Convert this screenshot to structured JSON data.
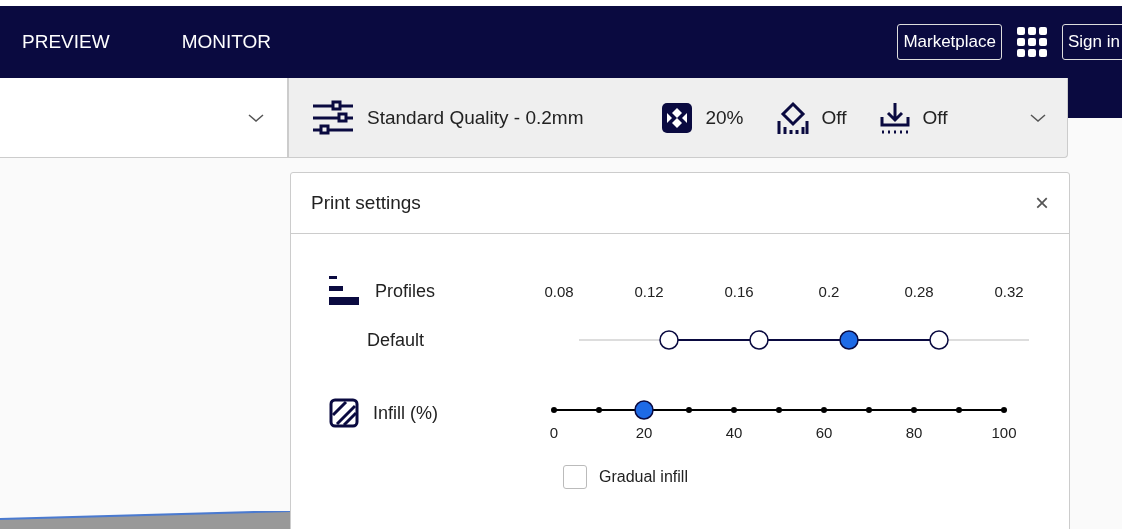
{
  "header": {
    "tabs": [
      {
        "label": "PREVIEW",
        "selected": false
      },
      {
        "label": "MONITOR",
        "selected": false
      }
    ],
    "marketplace_button": "Marketplace",
    "sign_in_button": "Sign in"
  },
  "settings_bar": {
    "profile": "Standard Quality - 0.2mm",
    "infill": "20%",
    "support": "Off",
    "adhesion": "Off"
  },
  "panel": {
    "title": "Print settings",
    "close": "×",
    "profiles": {
      "label": "Profiles",
      "sublabel": "Default",
      "stops": [
        {
          "label": "0.08",
          "available": false,
          "selected": false
        },
        {
          "label": "0.12",
          "available": true,
          "selected": false
        },
        {
          "label": "0.16",
          "available": true,
          "selected": false
        },
        {
          "label": "0.2",
          "available": true,
          "selected": true
        },
        {
          "label": "0.28",
          "available": true,
          "selected": false
        },
        {
          "label": "0.32",
          "available": false,
          "selected": false
        }
      ]
    },
    "infill": {
      "label": "Infill (%)",
      "level": 0.2,
      "ticks": [
        "0",
        "20",
        "40",
        "60",
        "80",
        "100"
      ]
    },
    "gradual_infill": {
      "label": "Gradual infill",
      "checked": false
    }
  }
}
